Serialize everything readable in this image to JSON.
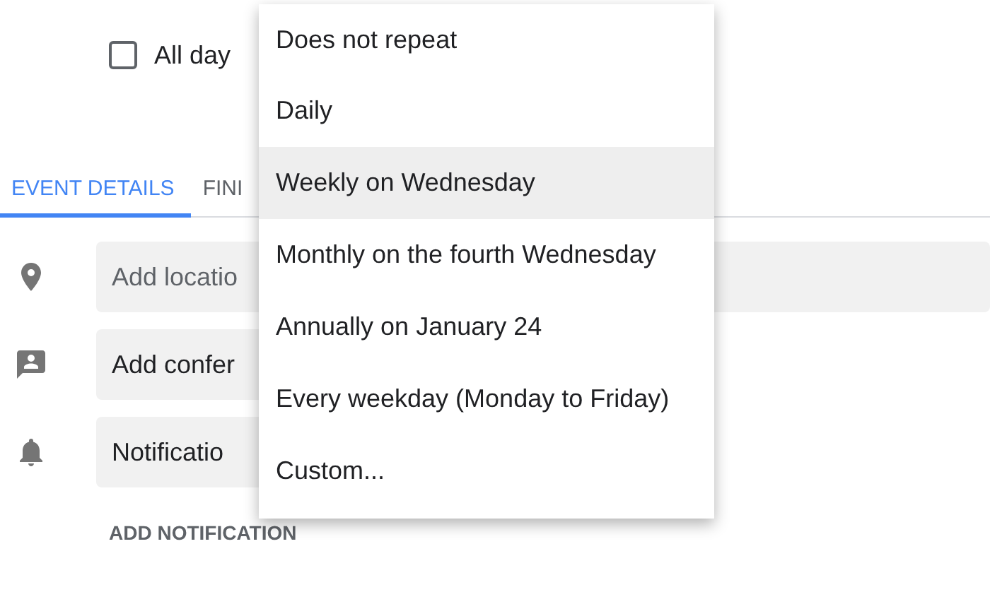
{
  "all_day": {
    "label": "All day",
    "checked": false
  },
  "tabs": [
    {
      "label": "EVENT DETAILS",
      "selected": true
    },
    {
      "label": "FINI",
      "selected": false
    }
  ],
  "fields": [
    {
      "kind": "location",
      "placeholder": "Add locatio"
    },
    {
      "kind": "conference",
      "value": "Add confer"
    },
    {
      "kind": "notification",
      "value": "Notificatio"
    }
  ],
  "add_notification": "ADD NOTIFICATION",
  "repeat_menu": [
    {
      "label": "Does not repeat",
      "selected": false
    },
    {
      "label": "Daily",
      "selected": false
    },
    {
      "label": "Weekly on Wednesday",
      "selected": true
    },
    {
      "label": "Monthly on the fourth Wednesday",
      "selected": false
    },
    {
      "label": "Annually on January 24",
      "selected": false
    },
    {
      "label": "Every weekday (Monday to Friday)",
      "selected": false
    },
    {
      "label": "Custom...",
      "selected": false
    }
  ]
}
